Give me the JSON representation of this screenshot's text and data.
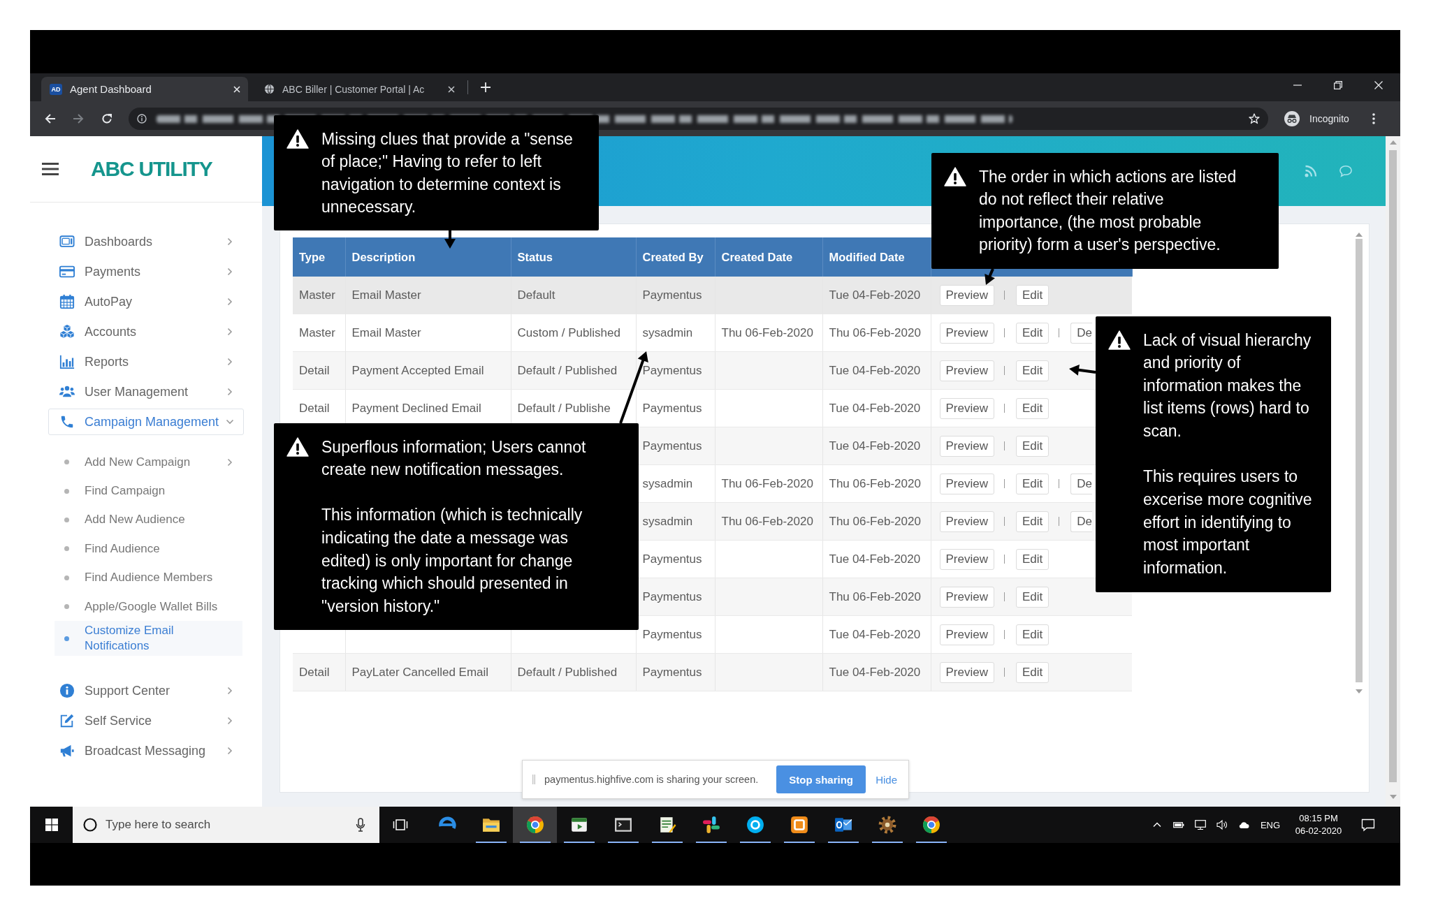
{
  "browser": {
    "tabs": [
      {
        "favicon": "AD",
        "label": "Agent Dashboard",
        "selected": true
      },
      {
        "label": "ABC Biller | Customer Portal | Ac",
        "selected": false
      }
    ],
    "nav_buttons": [
      {
        "kind": "back",
        "disabled": false
      },
      {
        "kind": "forward",
        "disabled": true
      },
      {
        "kind": "reload",
        "disabled": false
      }
    ],
    "profile_label": "Incognito"
  },
  "sidebar": {
    "logo": "ABC UTILITY",
    "items": [
      {
        "label": "Dashboards",
        "expanded": false,
        "selected": false
      },
      {
        "label": "Payments",
        "expanded": false,
        "selected": false
      },
      {
        "label": "AutoPay",
        "expanded": false,
        "selected": false
      },
      {
        "label": "Accounts",
        "expanded": false,
        "selected": false
      },
      {
        "label": "Reports",
        "expanded": false,
        "selected": false
      },
      {
        "label": "User Management",
        "expanded": false,
        "selected": false
      },
      {
        "label": "Campaign Management",
        "expanded": true,
        "selected": true,
        "children": [
          {
            "label": "Add New Campaign",
            "expandable": true,
            "selected": false
          },
          {
            "label": "Find Campaign",
            "expandable": false,
            "selected": false
          },
          {
            "label": "Add New Audience",
            "expandable": false,
            "selected": false
          },
          {
            "label": "Find Audience",
            "expandable": false,
            "selected": false
          },
          {
            "label": "Find Audience Members",
            "expandable": false,
            "selected": false
          },
          {
            "label": "Apple/Google Wallet Bills",
            "expandable": false,
            "selected": false
          },
          {
            "label": "Customize Email Notifications",
            "expandable": false,
            "selected": true
          }
        ]
      },
      {
        "label": "Support Center",
        "expanded": false,
        "selected": false
      },
      {
        "label": "Self Service",
        "expanded": false,
        "selected": false
      },
      {
        "label": "Broadcast Messaging",
        "expanded": false,
        "selected": false
      }
    ]
  },
  "table": {
    "columns": [
      "Type",
      "Description",
      "Status",
      "Created By",
      "Created Date",
      "Modified Date"
    ],
    "rows": [
      {
        "type": "Master",
        "description": "Email Master",
        "status": "Default",
        "created_by": "Paymentus",
        "modified_date": "Tue 04-Feb-2020",
        "actions": [
          "Preview",
          "Edit"
        ],
        "highlighted": true
      },
      {
        "type": "Master",
        "description": "Email Master",
        "status": "Custom / Published",
        "created_by": "sysadmin",
        "created_date": "Thu 06-Feb-2020",
        "modified_date": "Thu 06-Feb-2020",
        "actions": [
          "Preview",
          "Edit",
          "De"
        ],
        "highlighted": false
      },
      {
        "type": "Detail",
        "description": "Payment Accepted Email",
        "status": "Default / Published",
        "created_by": "Paymentus",
        "modified_date": "Tue 04-Feb-2020",
        "actions": [
          "Preview",
          "Edit"
        ],
        "highlighted": false
      },
      {
        "type": "Detail",
        "description": "Payment Declined Email",
        "status": "Default / Publishe",
        "created_by": "Paymentus",
        "modified_date": "Tue 04-Feb-2020",
        "actions": [
          "Preview",
          "Edit"
        ],
        "highlighted": false
      },
      {
        "created_by": "Paymentus",
        "modified_date": "Tue 04-Feb-2020",
        "actions": [
          "Preview",
          "Edit"
        ],
        "highlighted": false
      },
      {
        "created_by": "sysadmin",
        "created_date": "Thu 06-Feb-2020",
        "modified_date": "Thu 06-Feb-2020",
        "actions": [
          "Preview",
          "Edit",
          "De"
        ],
        "highlighted": false
      },
      {
        "created_by": "sysadmin",
        "created_date": "Thu 06-Feb-2020",
        "modified_date": "Thu 06-Feb-2020",
        "actions": [
          "Preview",
          "Edit",
          "De"
        ],
        "highlighted": false
      },
      {
        "created_by": "Paymentus",
        "modified_date": "Tue 04-Feb-2020",
        "actions": [
          "Preview",
          "Edit"
        ],
        "highlighted": false
      },
      {
        "created_by": "Paymentus",
        "modified_date": "Thu 06-Feb-2020",
        "actions": [
          "Preview",
          "Edit"
        ],
        "highlighted": false
      },
      {
        "created_by": "Paymentus",
        "modified_date": "Tue 04-Feb-2020",
        "actions": [
          "Preview",
          "Edit"
        ],
        "highlighted": false
      },
      {
        "type": "Detail",
        "description": "PayLater Cancelled Email",
        "status": "Default / Published",
        "created_by": "Paymentus",
        "modified_date": "Tue 04-Feb-2020",
        "actions": [
          "Preview",
          "Edit"
        ],
        "highlighted": false
      }
    ]
  },
  "screen_share": {
    "message": "paymentus.highfive.com is sharing your screen.",
    "stop_button": "Stop sharing",
    "hide_link": "Hide"
  },
  "callouts": [
    {
      "paragraphs": [
        "Missing clues that provide a \"sense of place;\" Having to refer to left navigation to determine context is unnecessary."
      ]
    },
    {
      "paragraphs": [
        "The order in which actions are listed do not reflect their relative importance, (the most probable priority) form a user's perspective."
      ]
    },
    {
      "paragraphs": [
        "Lack of visual hierarchy and priority of information makes the list items (rows) hard to scan.",
        "This requires users to excerise more cognitive effort in identifying to most important information."
      ]
    },
    {
      "paragraphs": [
        "Superflous information; Users cannot create new notification messages.",
        "This information (which is technically indicating the date a message was edited) is only important for change tracking which should presented in \"version history.\""
      ]
    }
  ],
  "taskbar": {
    "search": {
      "placeholder": "Type here to search"
    },
    "apps": [
      {
        "kind": "swirl",
        "running": false,
        "selected": false
      },
      {
        "kind": "folder",
        "running": true,
        "selected": false
      },
      {
        "kind": "orb",
        "running": true,
        "selected": true
      },
      {
        "kind": "player",
        "running": true,
        "selected": false
      },
      {
        "kind": "console",
        "running": true,
        "selected": false
      },
      {
        "kind": "notes",
        "running": true,
        "selected": false
      },
      {
        "kind": "pinwheel",
        "running": true,
        "selected": false
      },
      {
        "kind": "bubble",
        "running": true,
        "selected": false
      },
      {
        "kind": "tile",
        "running": true,
        "selected": false
      },
      {
        "kind": "mail",
        "running": true,
        "selected": false
      },
      {
        "kind": "gear",
        "running": true,
        "selected": false
      },
      {
        "kind": "orb",
        "running": true,
        "selected": false
      }
    ],
    "language": "ENG",
    "time": "08:15 PM",
    "date": "06-02-2020"
  }
}
